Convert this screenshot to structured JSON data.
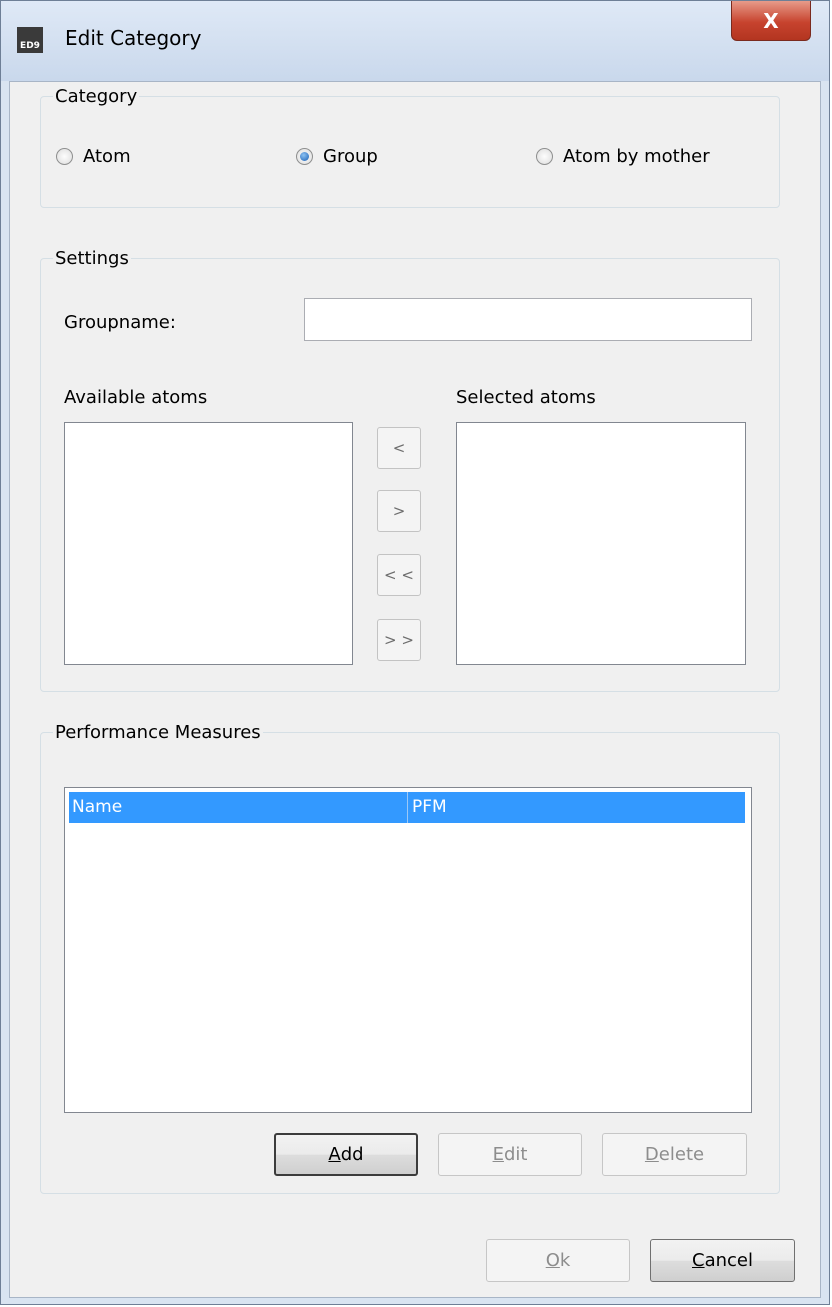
{
  "window": {
    "title": "Edit Category",
    "app_icon_text": "ED9",
    "close_glyph": "X"
  },
  "category": {
    "legend": "Category",
    "options": [
      {
        "label": "Atom",
        "checked": false
      },
      {
        "label": "Group",
        "checked": true
      },
      {
        "label": "Atom by mother",
        "checked": false
      }
    ]
  },
  "settings": {
    "legend": "Settings",
    "groupname_label": "Groupname:",
    "groupname_value": "",
    "available_label": "Available atoms",
    "selected_label": "Selected atoms",
    "move_buttons": [
      "<",
      ">",
      "< <",
      "> >"
    ]
  },
  "performance": {
    "legend": "Performance Measures",
    "columns": [
      "Name",
      "PFM"
    ],
    "rows": [],
    "add_mnemonic": "A",
    "add_rest": "dd",
    "edit_mnemonic": "E",
    "edit_rest": "dit",
    "delete_mnemonic": "D",
    "delete_rest": "elete"
  },
  "footer": {
    "ok_mnemonic": "O",
    "ok_rest": "k",
    "cancel_mnemonic": "C",
    "cancel_rest": "ancel"
  }
}
